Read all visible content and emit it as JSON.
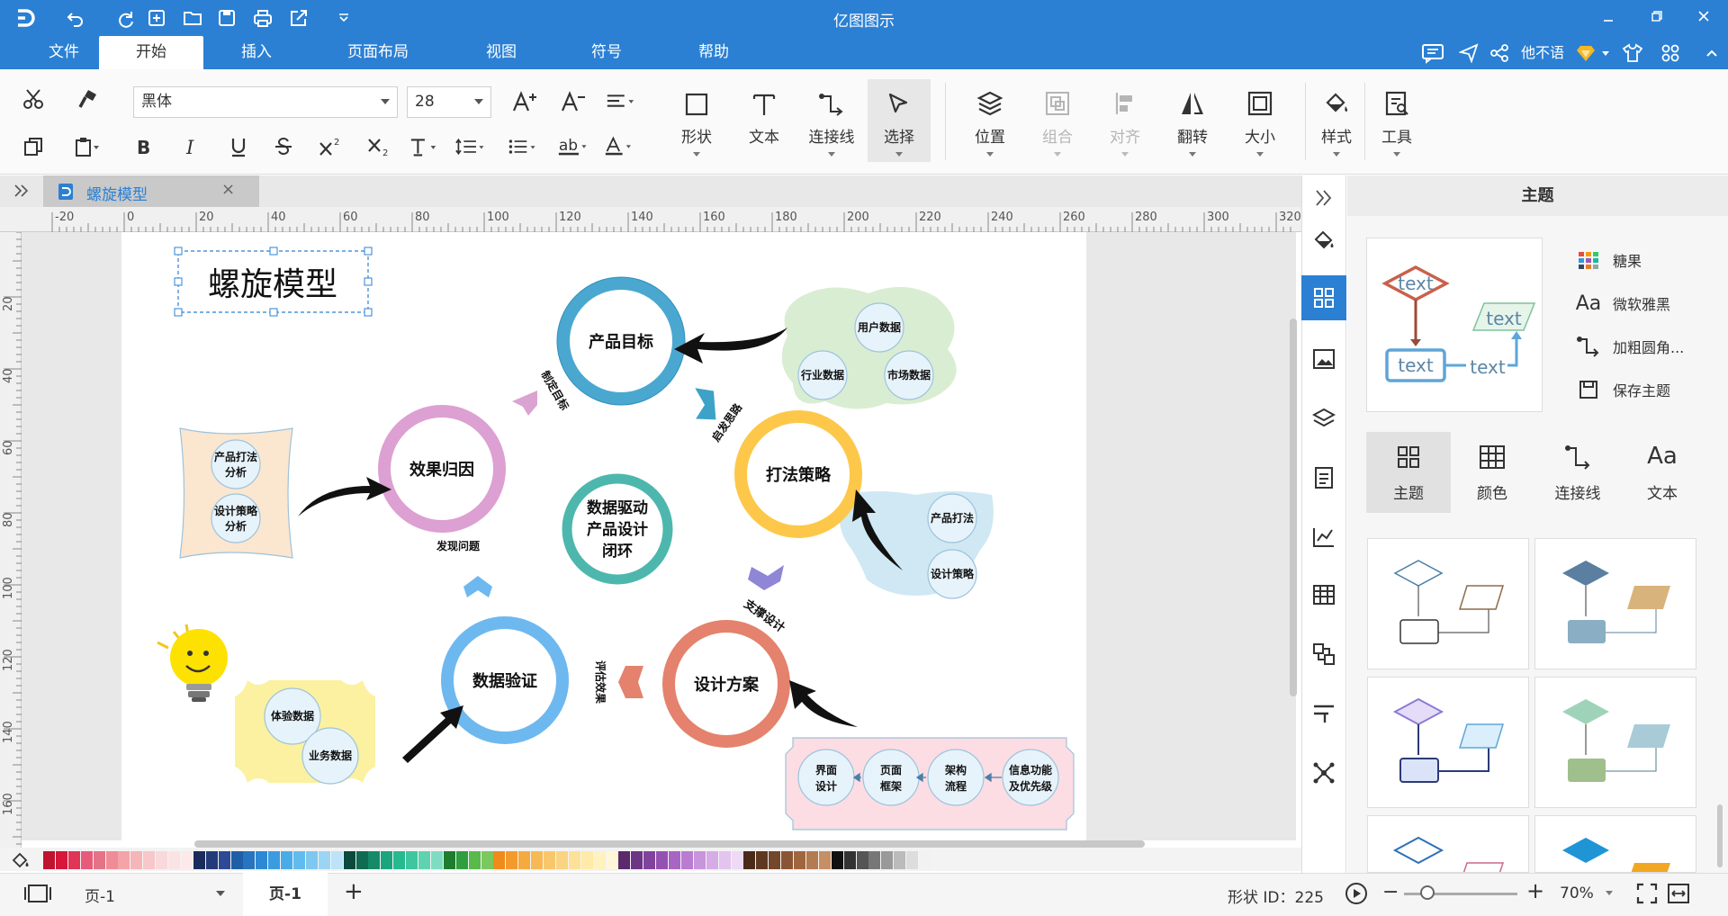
{
  "app": {
    "title": "亿图图示"
  },
  "menu": {
    "items": [
      "文件",
      "开始",
      "插入",
      "页面布局",
      "视图",
      "符号",
      "帮助"
    ],
    "active": "开始"
  },
  "user": {
    "name": "他不语"
  },
  "toolbar": {
    "font_name": "黑体",
    "font_size": "28",
    "shape": "形状",
    "text": "文本",
    "connector": "连接线",
    "select": "选择",
    "position": "位置",
    "group": "组合",
    "align": "对齐",
    "flip": "翻转",
    "size": "大小",
    "style": "样式",
    "tools": "工具"
  },
  "tab": {
    "name": "螺旋模型"
  },
  "ruler": {
    "h_ticks": [
      "-20",
      "0",
      "20",
      "40",
      "60",
      "80",
      "100",
      "120",
      "140",
      "160",
      "180",
      "200",
      "220",
      "240",
      "260",
      "280",
      "300",
      "320"
    ],
    "v_ticks": [
      "20",
      "40",
      "60",
      "80",
      "100",
      "120",
      "140",
      "160"
    ]
  },
  "diagram": {
    "title": "螺旋模型",
    "product_goal": "产品目标",
    "play_strategy": "打法策略",
    "design_plan": "设计方案",
    "data_verify": "数据验证",
    "effect_attribution": "效果归因",
    "center_line1": "数据驱动",
    "center_line2": "产品设计",
    "center_line3": "闭环",
    "label_set_goal": "制定目标",
    "label_inspire": "启发思路",
    "label_support": "支撑设计",
    "label_evaluate": "评估效果",
    "label_discover": "发现问题",
    "user_data": "用户数据",
    "industry_data": "行业数据",
    "market_data": "市场数据",
    "product_play": "产品打法",
    "design_strategy": "设计策略",
    "play_analysis_1": "产品打法",
    "play_analysis_2": "分析",
    "strategy_analysis_1": "设计策略",
    "strategy_analysis_2": "分析",
    "experience_data": "体验数据",
    "business_data": "业务数据",
    "ui_1": "界面",
    "ui_2": "设计",
    "page_1": "页面",
    "page_2": "框架",
    "arch_1": "架构",
    "arch_2": "流程",
    "info_1": "信息功能",
    "info_2": "及优先级"
  },
  "panel": {
    "title": "主题",
    "options": [
      "糖果",
      "微软雅黑",
      "加粗圆角...",
      "保存主题"
    ],
    "tabs": [
      "主题",
      "颜色",
      "连接线",
      "文本"
    ],
    "preview_text": "text"
  },
  "status": {
    "page_selector": "页-1",
    "page_tab": "页-1",
    "shape_id": "形状 ID：225",
    "zoom": "70%"
  },
  "colors": {
    "accent": "#2b80d4",
    "goal_ring": "#4aa8d0",
    "strategy_ring": "#fdc84a",
    "design_ring": "#e4826d",
    "verify_ring": "#6eb8f0",
    "effect_ring": "#dda0d2",
    "center_ring": "#4db7ad"
  }
}
